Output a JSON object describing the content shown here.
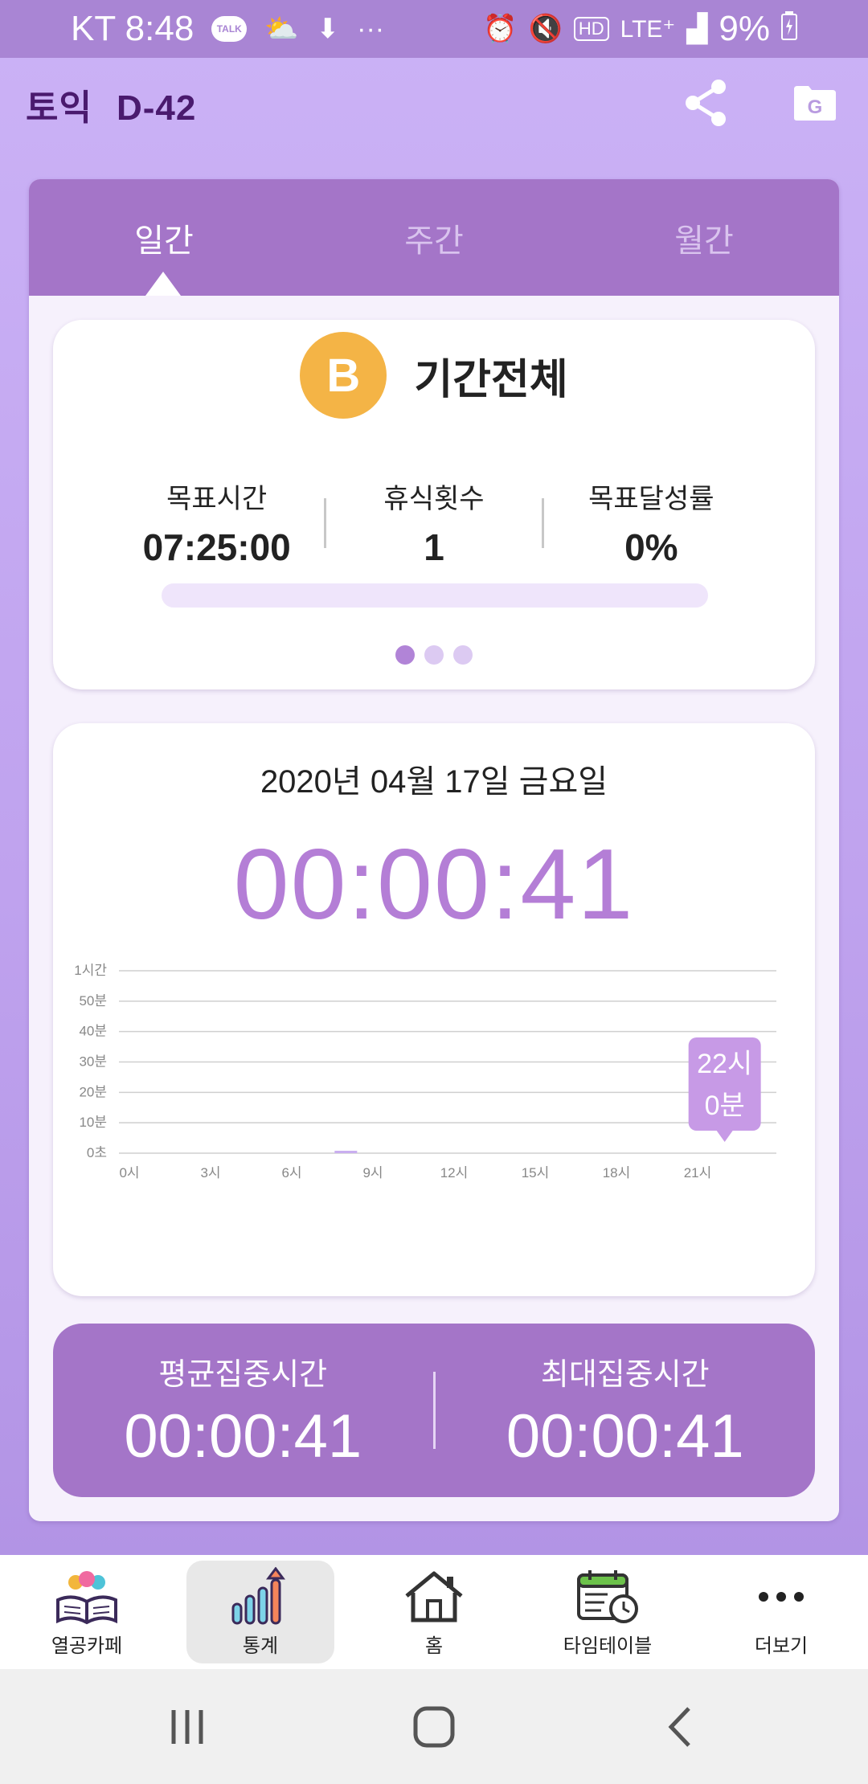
{
  "status_bar": {
    "carrier_time": "KT 8:48",
    "talk_badge": "TALK",
    "overflow": "···",
    "network": "LTE⁺",
    "hd": "HD",
    "battery": "9%"
  },
  "header": {
    "title": "토익",
    "dday": "D-42",
    "icons": [
      "share-icon",
      "google-drive-icon"
    ]
  },
  "tabs": [
    {
      "label": "일간",
      "active": true
    },
    {
      "label": "주간",
      "active": false
    },
    {
      "label": "월간",
      "active": false
    }
  ],
  "summary": {
    "grade": "B",
    "grade_label": "기간전체",
    "stats": [
      {
        "label": "목표시간",
        "value": "07:25:00"
      },
      {
        "label": "휴식횟수",
        "value": "1"
      },
      {
        "label": "목표달성률",
        "value": "0%"
      }
    ],
    "progress": 0,
    "page_count": 3,
    "active_page": 1
  },
  "daily": {
    "date": "2020년 04월 17일 금요일",
    "total_time": "00:00:41"
  },
  "chart_data": {
    "type": "bar",
    "x_tick_labels": [
      "0시",
      "3시",
      "6시",
      "9시",
      "12시",
      "15시",
      "18시",
      "21시"
    ],
    "y_tick_labels": [
      "0초",
      "10분",
      "20분",
      "30분",
      "40분",
      "50분",
      "1시간"
    ],
    "hours": [
      0,
      1,
      2,
      3,
      4,
      5,
      6,
      7,
      8,
      9,
      10,
      11,
      12,
      13,
      14,
      15,
      16,
      17,
      18,
      19,
      20,
      21,
      22,
      23
    ],
    "values_seconds": [
      0,
      0,
      0,
      0,
      0,
      0,
      0,
      0,
      41,
      0,
      0,
      0,
      0,
      0,
      0,
      0,
      0,
      0,
      0,
      0,
      0,
      0,
      0,
      0
    ],
    "ylim_seconds": [
      0,
      3600
    ],
    "grid": true,
    "tooltip": {
      "line1": "22시",
      "line2": "0분",
      "hour": 22
    }
  },
  "focus": {
    "average_label": "평균집중시간",
    "average_value": "00:00:41",
    "max_label": "최대집중시간",
    "max_value": "00:00:41"
  },
  "bottom_nav": [
    {
      "label": "열공카페",
      "icon": "study-cafe-icon",
      "active": false
    },
    {
      "label": "통계",
      "icon": "stats-icon",
      "active": true
    },
    {
      "label": "홈",
      "icon": "home-icon",
      "active": false
    },
    {
      "label": "타임테이블",
      "icon": "timetable-icon",
      "active": false
    },
    {
      "label": "더보기",
      "icon": "more-icon",
      "active": false
    }
  ],
  "colors": {
    "accent": "#a475c8",
    "timer": "#b47ed6",
    "grade_badge": "#f4b446",
    "background": "#c9aff5"
  }
}
